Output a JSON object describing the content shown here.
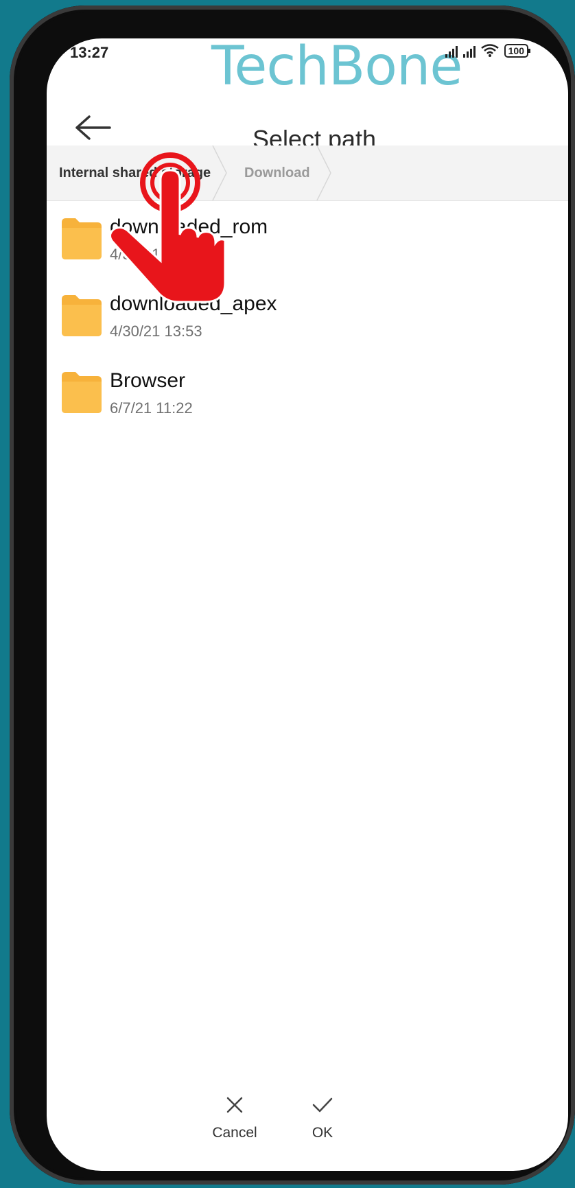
{
  "status": {
    "time": "13:27",
    "battery": "100"
  },
  "watermark": "TechBone",
  "header": {
    "title": "Select path"
  },
  "breadcrumb": [
    {
      "label": "Internal shared storage"
    },
    {
      "label": "Download"
    }
  ],
  "folders": [
    {
      "name": "downloaded_rom",
      "date": "4/30/21 13:12"
    },
    {
      "name": "downloaded_apex",
      "date": "4/30/21 13:53"
    },
    {
      "name": "Browser",
      "date": "6/7/21 11:22"
    }
  ],
  "actions": {
    "cancel": "Cancel",
    "ok": "OK"
  },
  "colors": {
    "folder": "#f7b23b",
    "accent_hand": "#e8151b",
    "background": "#127a8c"
  }
}
